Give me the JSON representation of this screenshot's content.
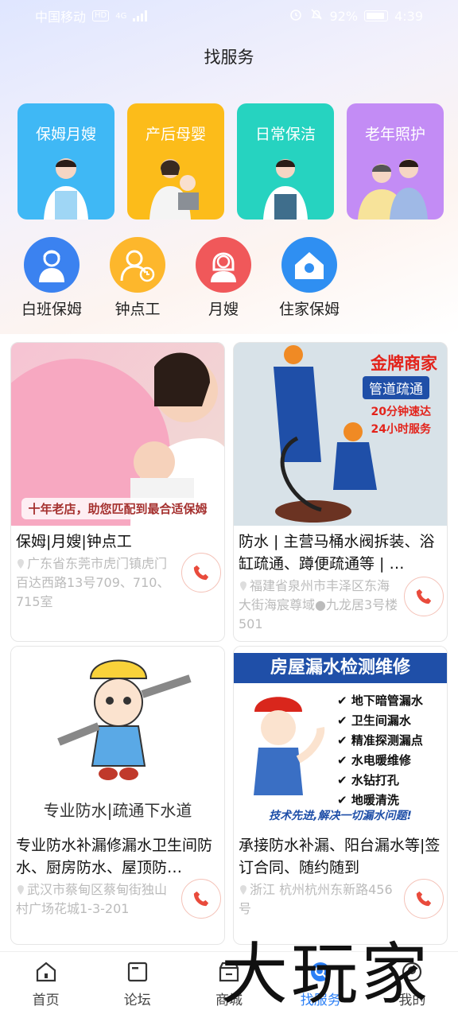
{
  "status": {
    "carrier": "中国移动",
    "hd": "HD",
    "net": "4G",
    "battery": "92%",
    "time": "4:39"
  },
  "page_title": "找服务",
  "categories": [
    {
      "label": "保姆月嫂",
      "color": "#3fb8f5"
    },
    {
      "label": "产后母婴",
      "color": "#fcbc1a"
    },
    {
      "label": "日常保洁",
      "color": "#26d3c0"
    },
    {
      "label": "老年照护",
      "color": "#c38cf5"
    }
  ],
  "quick": [
    {
      "label": "白班保姆",
      "color": "#3b82f0",
      "icon": "nanny-icon"
    },
    {
      "label": "钟点工",
      "color": "#fdb72c",
      "icon": "hourly-worker-icon"
    },
    {
      "label": "月嫂",
      "color": "#f0585a",
      "icon": "maternity-nurse-icon"
    },
    {
      "label": "住家保姆",
      "color": "#2f8ff2",
      "icon": "home-icon"
    }
  ],
  "listings": [
    {
      "title": "保姆|月嫂|钟点工",
      "address": "广东省东莞市虎门镇虎门百达西路13号709、710、715室",
      "image_banner": "十年老店，助您匹配到最合适保姆"
    },
    {
      "title": "防水 | 主营马桶水阀拆装、浴缸疏通、蹲便疏通等 | …",
      "address": "福建省泉州市丰泽区东海大街海宸尊域●九龙居3号楼501",
      "image_badge1": "金牌商家",
      "image_badge2": "管道疏通",
      "image_badge3": "20分钟速达",
      "image_badge4": "24小时服务"
    },
    {
      "title": "专业防水补漏修漏水卫生间防水、厨房防水、屋顶防…",
      "address": "武汉市蔡甸区蔡甸街独山村广场花城1-3-201",
      "image_caption": "专业防水|疏通下水道"
    },
    {
      "title": "承接防水补漏、阳台漏水等|签订合同、随约随到",
      "address": "浙江 杭州杭州东新路456号",
      "image_header": "房屋漏水检测维修",
      "image_items": [
        "地下暗管漏水",
        "卫生间漏水",
        "精准探测漏点",
        "水电暖维修",
        "水钻打孔",
        "地暖清洗"
      ],
      "image_footer": "技术先进,解决一切漏水问题!"
    }
  ],
  "tabs": [
    {
      "label": "首页",
      "icon": "home-tab-icon"
    },
    {
      "label": "论坛",
      "icon": "forum-tab-icon"
    },
    {
      "label": "商城",
      "icon": "shop-tab-icon"
    },
    {
      "label": "找服务",
      "icon": "search-service-tab-icon",
      "active": true
    },
    {
      "label": "我的",
      "icon": "profile-tab-icon"
    }
  ],
  "watermark": "大玩家",
  "accent": "#2b7ff6"
}
